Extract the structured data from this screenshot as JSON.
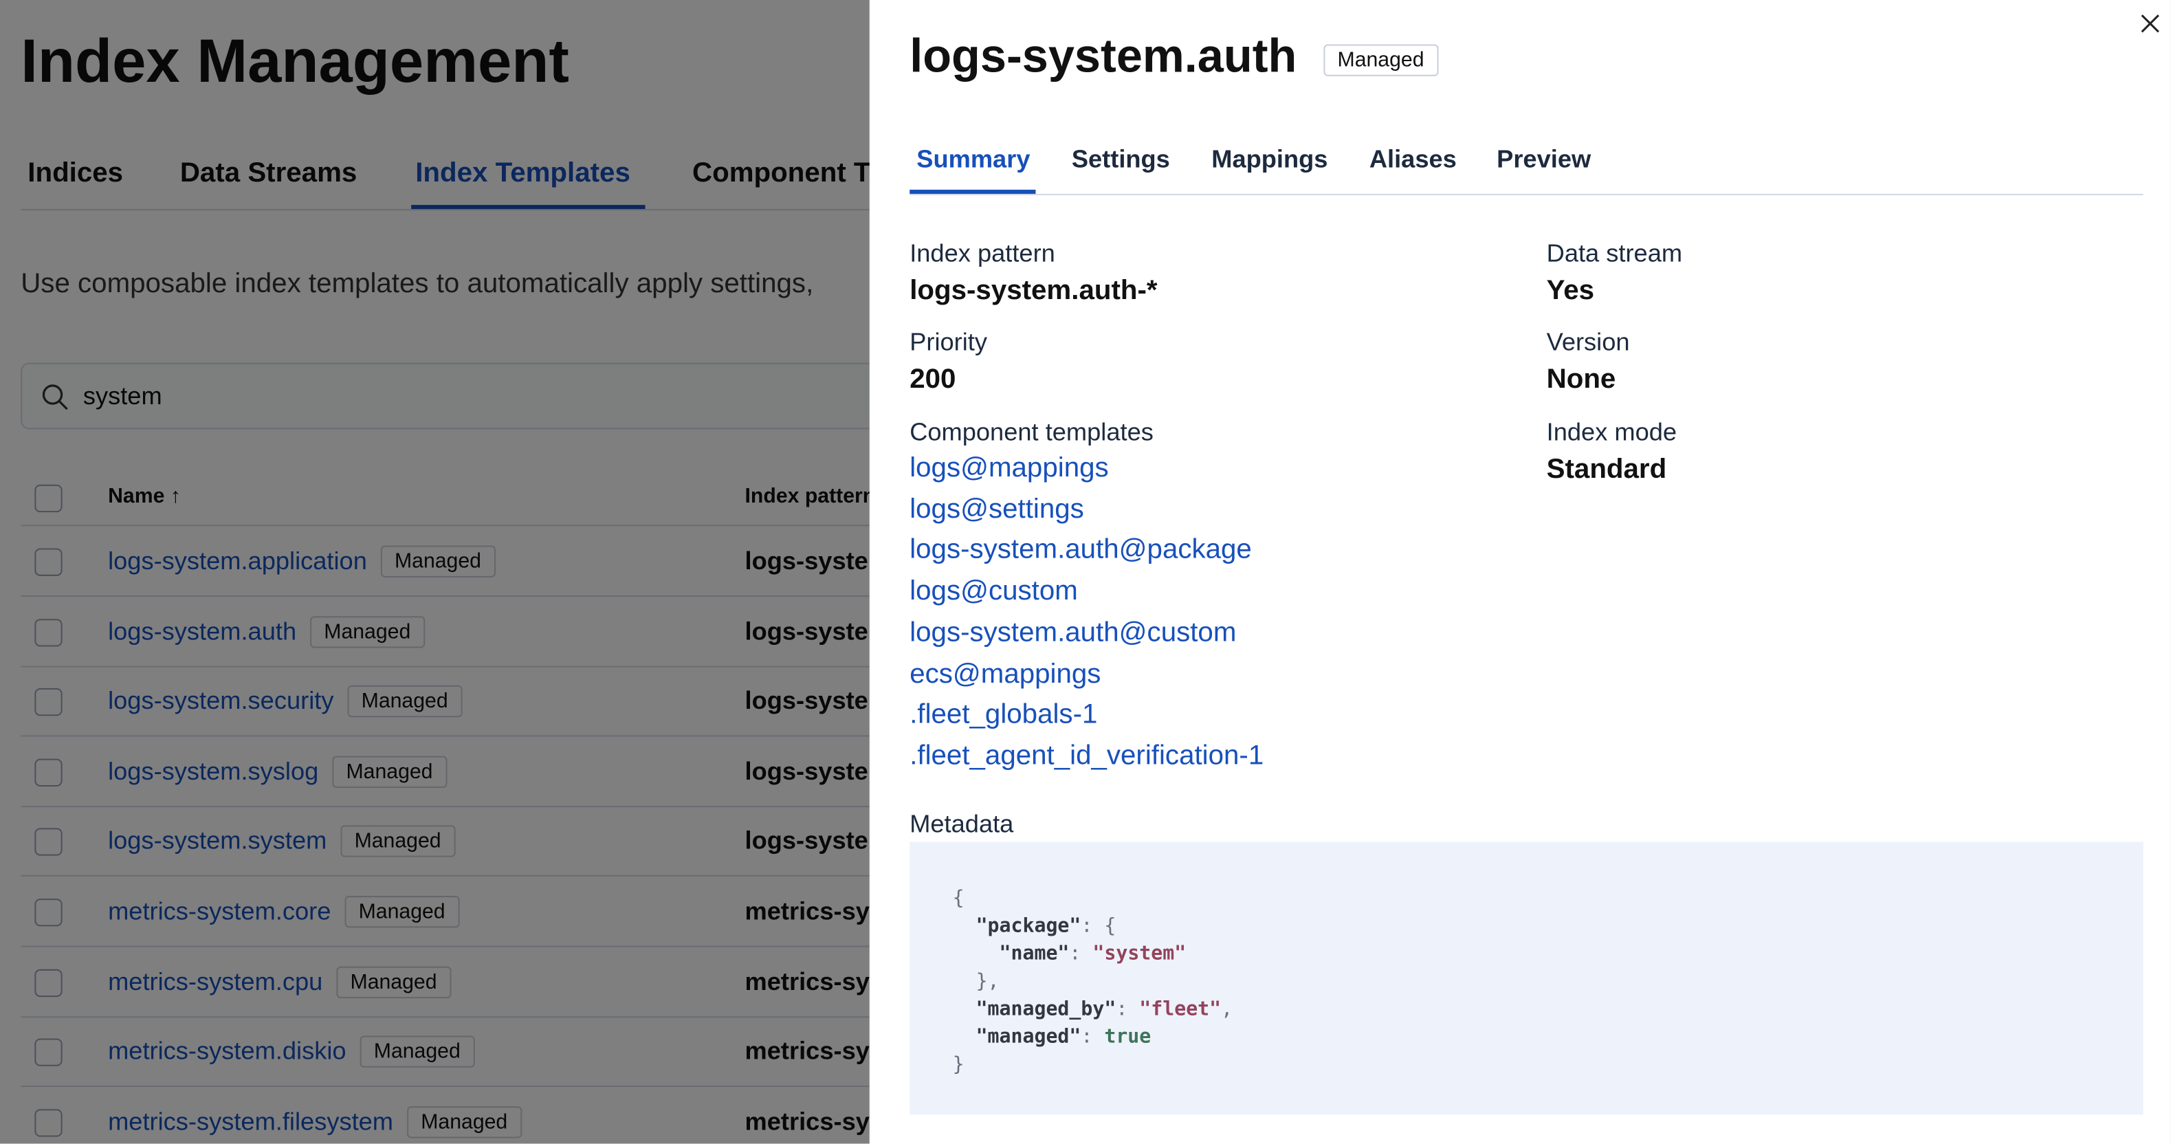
{
  "page": {
    "title": "Index Management",
    "tabs": [
      {
        "label": "Indices"
      },
      {
        "label": "Data Streams"
      },
      {
        "label": "Index Templates",
        "active": true
      },
      {
        "label": "Component T"
      }
    ],
    "description": "Use composable index templates to automatically apply settings,",
    "search": {
      "value": "system",
      "icon": "search-icon"
    },
    "table": {
      "headers": {
        "name": "Name",
        "sort": "↑",
        "pattern": "Index pattern"
      },
      "rows": [
        {
          "name": "logs-system.application",
          "badge": "Managed",
          "pattern": "logs-syste"
        },
        {
          "name": "logs-system.auth",
          "badge": "Managed",
          "pattern": "logs-syste"
        },
        {
          "name": "logs-system.security",
          "badge": "Managed",
          "pattern": "logs-syste"
        },
        {
          "name": "logs-system.syslog",
          "badge": "Managed",
          "pattern": "logs-syste"
        },
        {
          "name": "logs-system.system",
          "badge": "Managed",
          "pattern": "logs-syste"
        },
        {
          "name": "metrics-system.core",
          "badge": "Managed",
          "pattern": "metrics-sy"
        },
        {
          "name": "metrics-system.cpu",
          "badge": "Managed",
          "pattern": "metrics-sy"
        },
        {
          "name": "metrics-system.diskio",
          "badge": "Managed",
          "pattern": "metrics-sy"
        },
        {
          "name": "metrics-system.filesystem",
          "badge": "Managed",
          "pattern": "metrics-sy"
        }
      ]
    }
  },
  "flyout": {
    "title": "logs-system.auth",
    "badge": "Managed",
    "close_icon": "close-icon",
    "tabs": [
      {
        "label": "Summary",
        "active": true
      },
      {
        "label": "Settings"
      },
      {
        "label": "Mappings"
      },
      {
        "label": "Aliases"
      },
      {
        "label": "Preview"
      }
    ],
    "summary": {
      "index_pattern": {
        "label": "Index pattern",
        "value": "logs-system.auth-*"
      },
      "priority": {
        "label": "Priority",
        "value": "200"
      },
      "component_templates": {
        "label": "Component templates",
        "items": [
          "logs@mappings",
          "logs@settings",
          "logs-system.auth@package",
          "logs@custom",
          "logs-system.auth@custom",
          "ecs@mappings",
          ".fleet_globals-1",
          ".fleet_agent_id_verification-1"
        ]
      },
      "data_stream": {
        "label": "Data stream",
        "value": "Yes"
      },
      "version": {
        "label": "Version",
        "value": "None"
      },
      "index_mode": {
        "label": "Index mode",
        "value": "Standard"
      },
      "metadata": {
        "label": "Metadata",
        "package_key": "\"package\"",
        "name_key": "\"name\"",
        "name_value": "\"system\"",
        "managed_by_key": "\"managed_by\"",
        "managed_by_value": "\"fleet\"",
        "managed_key": "\"managed\"",
        "managed_value": "true"
      }
    }
  },
  "colors": {
    "accent": "#1750ba",
    "string": "#93435c",
    "boolean": "#3e7359",
    "code_bg": "#eef2fa"
  }
}
